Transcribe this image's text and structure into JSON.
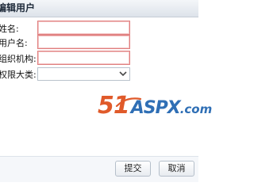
{
  "dialog": {
    "title": "编辑用户"
  },
  "form": {
    "fields": [
      {
        "label": "姓名:",
        "value": ""
      },
      {
        "label": "用户名:",
        "value": ""
      },
      {
        "label": "组织机构:",
        "value": ""
      }
    ],
    "permission": {
      "label": "权限大类:",
      "selected": ""
    }
  },
  "watermark": {
    "number": "51",
    "brand": "ASPX",
    "suffix": ".com",
    "colors": {
      "number": "#e05a2a",
      "brand": "#2f6fb5"
    }
  },
  "footer": {
    "submit_label": "提交",
    "cancel_label": "取消"
  },
  "colors": {
    "invalid_border": "#e08080",
    "title_bar": "#dde3ea"
  },
  "icons": {
    "select_arrow": "chevron-down-icon"
  }
}
